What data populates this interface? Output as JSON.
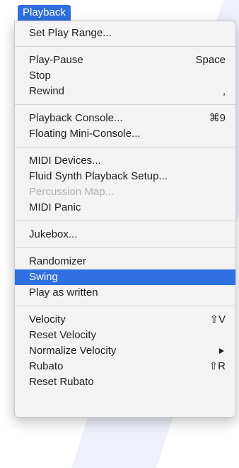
{
  "menu_title": "Playback",
  "groups": [
    [
      {
        "label": "Set Play Range...",
        "shortcut": ""
      }
    ],
    [
      {
        "label": "Play-Pause",
        "shortcut": "Space"
      },
      {
        "label": "Stop",
        "shortcut": ""
      },
      {
        "label": "Rewind",
        "shortcut": ","
      }
    ],
    [
      {
        "label": "Playback Console...",
        "shortcut": "⌘9"
      },
      {
        "label": "Floating Mini-Console...",
        "shortcut": ""
      }
    ],
    [
      {
        "label": "MIDI Devices...",
        "shortcut": ""
      },
      {
        "label": "Fluid Synth Playback Setup...",
        "shortcut": ""
      },
      {
        "label": "Percussion Map...",
        "shortcut": "",
        "disabled": true
      },
      {
        "label": "MIDI Panic",
        "shortcut": ""
      }
    ],
    [
      {
        "label": "Jukebox...",
        "shortcut": ""
      }
    ],
    [
      {
        "label": "Randomizer",
        "shortcut": ""
      },
      {
        "label": "Swing",
        "shortcut": "",
        "highlighted": true
      },
      {
        "label": "Play as written",
        "shortcut": ""
      }
    ],
    [
      {
        "label": "Velocity",
        "shortcut": "⇧V"
      },
      {
        "label": "Reset Velocity",
        "shortcut": ""
      },
      {
        "label": "Normalize Velocity",
        "shortcut": "",
        "submenu": true,
        "submenu_icon": "chevron-right-icon"
      },
      {
        "label": "Rubato",
        "shortcut": "⇧R"
      },
      {
        "label": "Reset Rubato",
        "shortcut": ""
      }
    ]
  ],
  "colors": {
    "accent": "#2f6fe0",
    "menu_bg": "#f3f3f3",
    "text": "#1f1f1f",
    "disabled_text": "#b2b2b2",
    "separator": "#d4d4d4"
  }
}
